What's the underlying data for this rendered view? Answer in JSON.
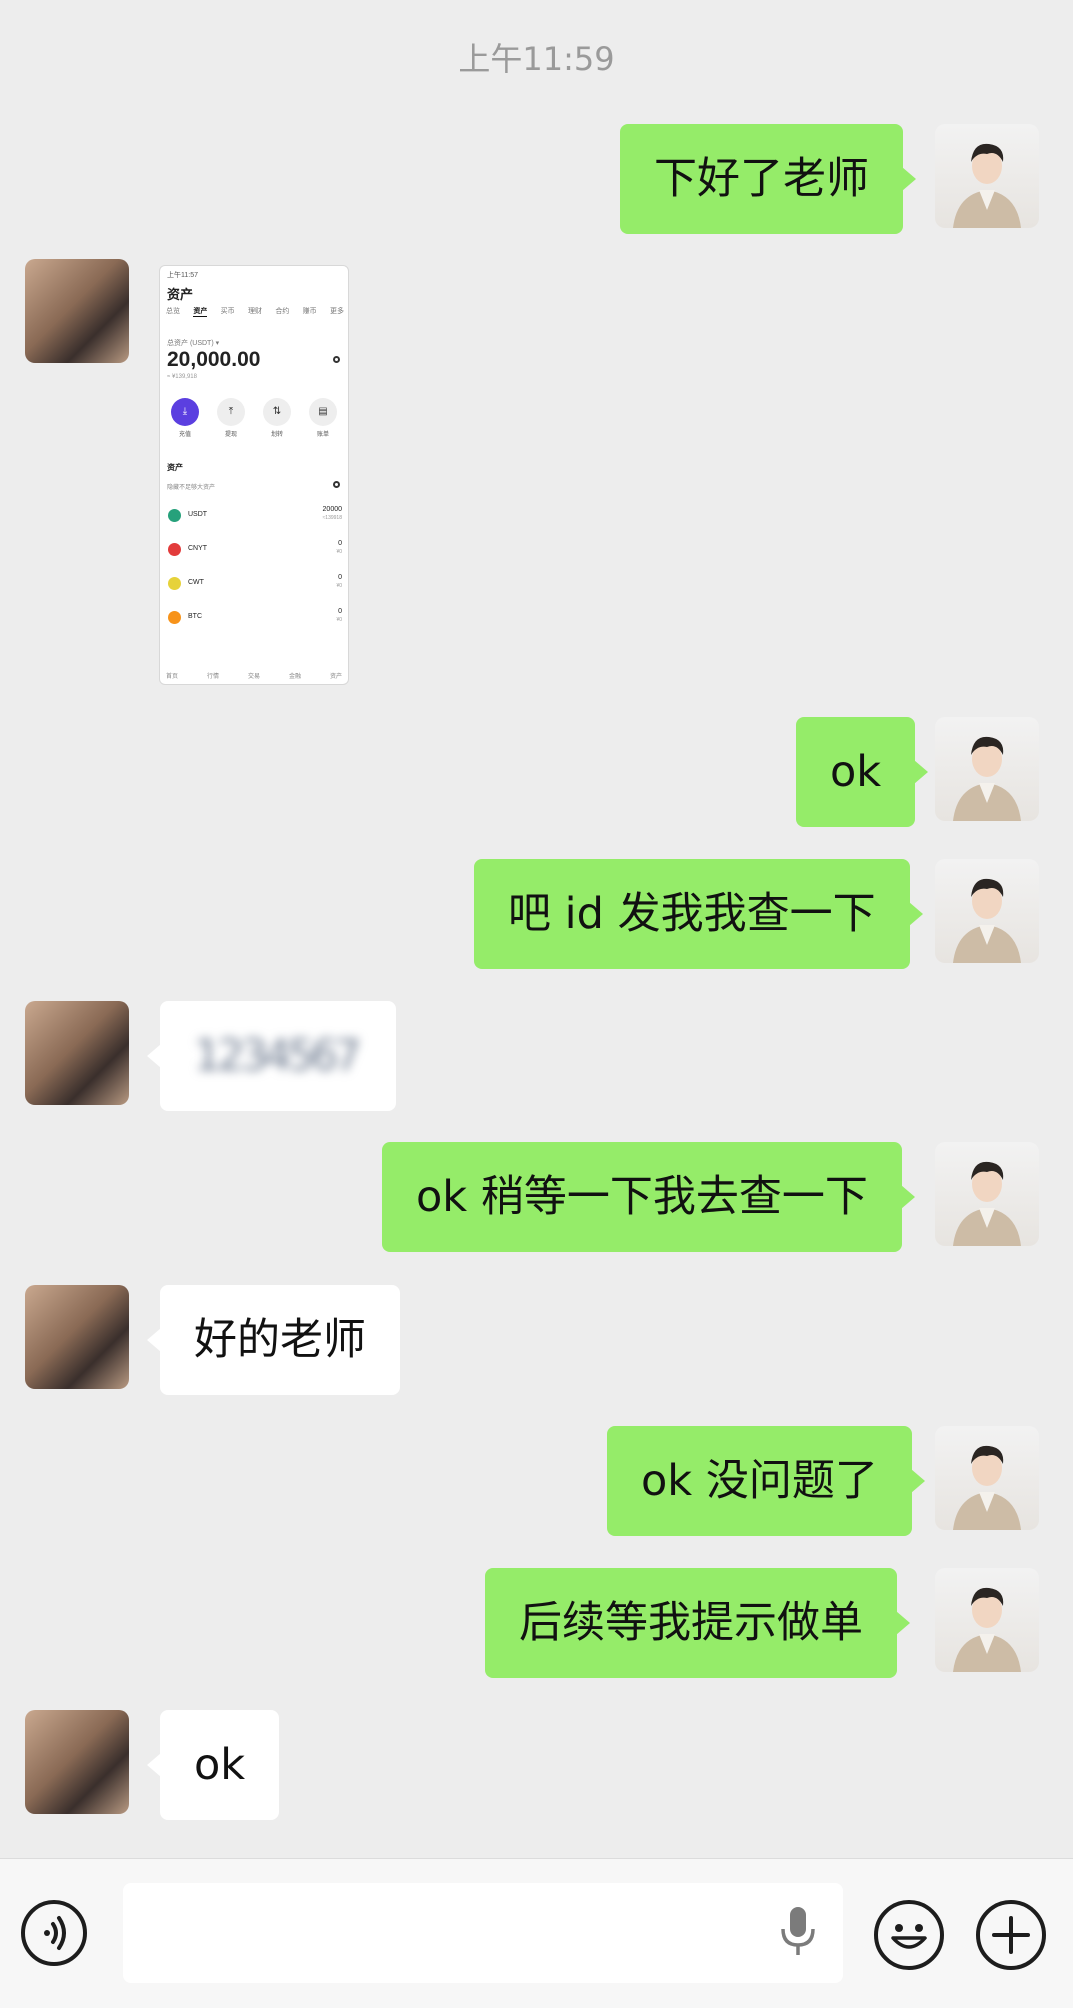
{
  "timestamp": "上午11:59",
  "messages": [
    {
      "side": "me",
      "text": "下好了老师"
    },
    {
      "side": "peer",
      "type": "image"
    },
    {
      "side": "me",
      "text": "ok"
    },
    {
      "side": "me",
      "text": "吧 id 发我我查一下"
    },
    {
      "side": "peer",
      "text": "1234567",
      "blurred": true
    },
    {
      "side": "me",
      "text": "ok 稍等一下我去查一下"
    },
    {
      "side": "peer",
      "text": "好的老师"
    },
    {
      "side": "me",
      "text": "ok 没问题了"
    },
    {
      "side": "me",
      "text": "后续等我提示做单"
    },
    {
      "side": "peer",
      "text": "ok"
    }
  ],
  "shared_screenshot": {
    "status_bar": "上午11:57",
    "title": "资产",
    "tabs": [
      "总览",
      "资产",
      "买币",
      "理财",
      "合约",
      "赚币",
      "更多"
    ],
    "active_tab": "资产",
    "total_label": "总资产 (USDT) ▾",
    "total_amount": "20,000.00",
    "total_sub": "≈ ¥139,918",
    "actions": [
      "充值",
      "提现",
      "划转",
      "账单"
    ],
    "section_title": "资产",
    "hide_small": "隐藏不足够大资产",
    "coins": [
      {
        "name": "USDT",
        "amount": "20000",
        "sub": "≈139918",
        "color": "#26a17b"
      },
      {
        "name": "CNYT",
        "amount": "0",
        "sub": "¥0",
        "color": "#e23b3b"
      },
      {
        "name": "CWT",
        "amount": "0",
        "sub": "¥0",
        "color": "#e6d23a"
      },
      {
        "name": "BTC",
        "amount": "0",
        "sub": "¥0",
        "color": "#f7931a"
      }
    ],
    "nav": [
      "首页",
      "行情",
      "交易",
      "金融",
      "资产"
    ]
  },
  "input": {
    "placeholder": ""
  },
  "icons": {
    "voice": "voice-icon",
    "mic": "microphone-icon",
    "emoji": "emoji-icon",
    "more": "plus-icon"
  }
}
